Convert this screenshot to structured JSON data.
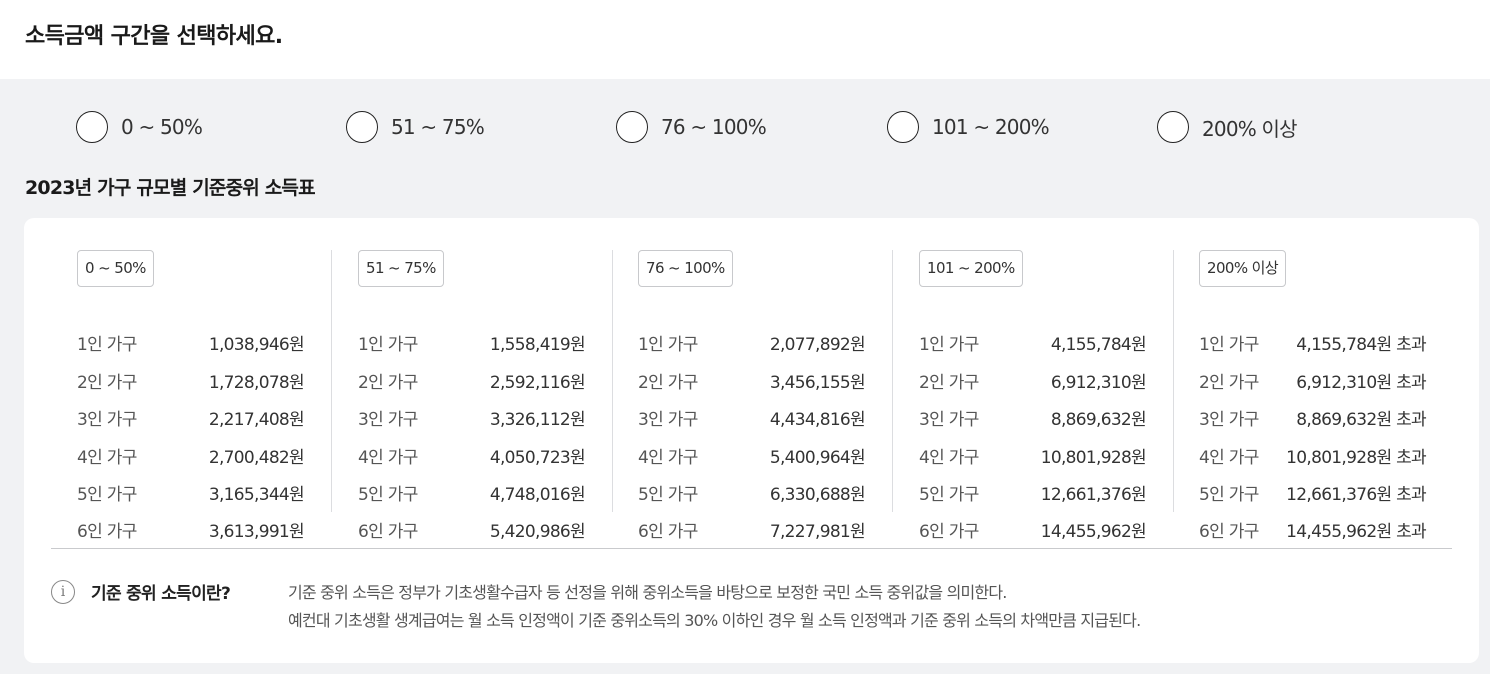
{
  "header": {
    "title": "소득금액 구간을 선택하세요."
  },
  "options": [
    {
      "label": "0 ~ 50%"
    },
    {
      "label": "51 ~ 75%"
    },
    {
      "label": "76 ~ 100%"
    },
    {
      "label": "101 ~ 200%"
    },
    {
      "label": "200% 이상"
    }
  ],
  "table": {
    "title": "2023년 가구 규모별 기준중위 소득표",
    "columns": [
      {
        "badge": "0 ~ 50%",
        "rows": [
          {
            "size": "1인 가구",
            "amount": "1,038,946원"
          },
          {
            "size": "2인 가구",
            "amount": "1,728,078원"
          },
          {
            "size": "3인 가구",
            "amount": "2,217,408원"
          },
          {
            "size": "4인 가구",
            "amount": "2,700,482원"
          },
          {
            "size": "5인 가구",
            "amount": "3,165,344원"
          },
          {
            "size": "6인 가구",
            "amount": "3,613,991원"
          }
        ]
      },
      {
        "badge": "51 ~ 75%",
        "rows": [
          {
            "size": "1인 가구",
            "amount": "1,558,419원"
          },
          {
            "size": "2인 가구",
            "amount": "2,592,116원"
          },
          {
            "size": "3인 가구",
            "amount": "3,326,112원"
          },
          {
            "size": "4인 가구",
            "amount": "4,050,723원"
          },
          {
            "size": "5인 가구",
            "amount": "4,748,016원"
          },
          {
            "size": "6인 가구",
            "amount": "5,420,986원"
          }
        ]
      },
      {
        "badge": "76 ~ 100%",
        "rows": [
          {
            "size": "1인 가구",
            "amount": "2,077,892원"
          },
          {
            "size": "2인 가구",
            "amount": "3,456,155원"
          },
          {
            "size": "3인 가구",
            "amount": "4,434,816원"
          },
          {
            "size": "4인 가구",
            "amount": "5,400,964원"
          },
          {
            "size": "5인 가구",
            "amount": "6,330,688원"
          },
          {
            "size": "6인 가구",
            "amount": "7,227,981원"
          }
        ]
      },
      {
        "badge": "101 ~ 200%",
        "rows": [
          {
            "size": "1인 가구",
            "amount": "4,155,784원"
          },
          {
            "size": "2인 가구",
            "amount": "6,912,310원"
          },
          {
            "size": "3인 가구",
            "amount": "8,869,632원"
          },
          {
            "size": "4인 가구",
            "amount": "10,801,928원"
          },
          {
            "size": "5인 가구",
            "amount": "12,661,376원"
          },
          {
            "size": "6인 가구",
            "amount": "14,455,962원"
          }
        ]
      },
      {
        "badge": "200% 이상",
        "rows": [
          {
            "size": "1인 가구",
            "amount": "4,155,784원 초과"
          },
          {
            "size": "2인 가구",
            "amount": "6,912,310원 초과"
          },
          {
            "size": "3인 가구",
            "amount": "8,869,632원 초과"
          },
          {
            "size": "4인 가구",
            "amount": "10,801,928원 초과"
          },
          {
            "size": "5인 가구",
            "amount": "12,661,376원 초과"
          },
          {
            "size": "6인 가구",
            "amount": "14,455,962원 초과"
          }
        ]
      }
    ]
  },
  "info": {
    "icon": "info-icon",
    "icon_glyph": "i",
    "title": "기준 중위 소득이란?",
    "line1": "기준 중위 소득은 정부가 기초생활수급자 등 선정을 위해 중위소득을 바탕으로 보정한 국민 소득 중위값을 의미한다.",
    "line2": "예컨대 기초생활 생계급여는 월 소득 인정액이 기준 중위소득의 30% 이하인 경우 월 소득 인정액과 기준 중위 소득의 차액만큼 지급된다."
  }
}
